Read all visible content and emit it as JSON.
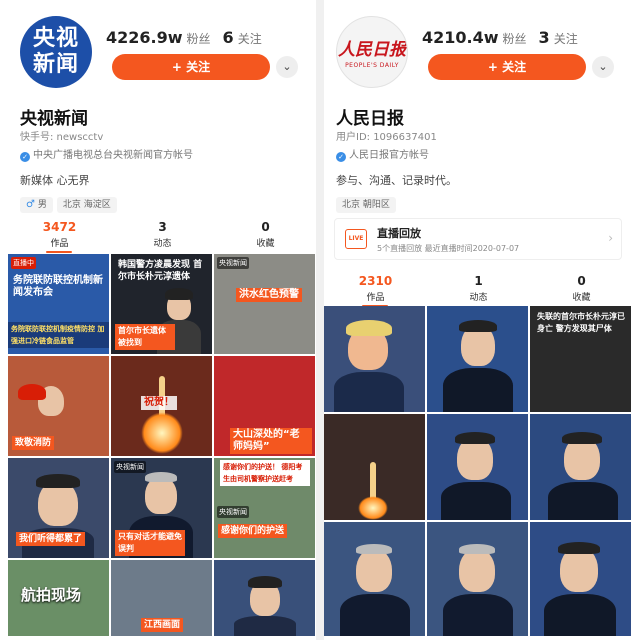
{
  "left": {
    "avatar_text": "央视\n新闻",
    "fans_count": "4226.9w",
    "fans_label": "粉丝",
    "follow_count": "6",
    "follow_label": "关注",
    "follow_button": "+ 关注",
    "more_icon": "chevron-down-icon",
    "name": "央视新闻",
    "account": "快手号: newscctv",
    "verification": "中央广播电视总台央视新闻官方帐号",
    "bio": "新媒体 心无界",
    "tags": [
      "男",
      "北京 海淀区"
    ],
    "tabs": [
      {
        "count": "3472",
        "label": "作品",
        "active": true
      },
      {
        "count": "3",
        "label": "动态",
        "active": false
      },
      {
        "count": "0",
        "label": "收藏",
        "active": false
      }
    ],
    "tiles": [
      {
        "caption": "务院联防联控机制新闻发布会",
        "badge": "直播中",
        "sub": "务院联防联控机制疫情防控 加强进口冷链食品监管",
        "bg": "#2a5aa8"
      },
      {
        "caption": "韩国警方凌晨发现 首尔市长朴元淳遗体",
        "badge": "",
        "sub": "首尔市长遗体被找到",
        "bg": "#20242c"
      },
      {
        "caption": "洪水红色预警",
        "badge": "央视新闻",
        "sub": "",
        "bg": "#8c8c86"
      },
      {
        "caption": "致敬消防",
        "badge": "",
        "sub": "",
        "bg": "#b85a3a"
      },
      {
        "caption": "祝贺！",
        "badge": "",
        "sub": "",
        "bg": "#6b2a1c"
      },
      {
        "caption": "大山深处的“老师妈妈”",
        "badge": "",
        "sub": "",
        "bg": "#c0282a"
      },
      {
        "caption": "我们听得都累了",
        "badge": "",
        "sub": "",
        "bg": "#3b4a6a"
      },
      {
        "caption": "只有对话才能避免误判",
        "badge": "央视新闻",
        "sub": "",
        "bg": "#2b3850"
      },
      {
        "caption": "感谢你们的护送",
        "badge": "央视新闻",
        "sub": "感谢你们的护送！ 德阳考生由司机警察护送赶考",
        "bg": "#6f8a6a"
      },
      {
        "caption": "航拍现场",
        "badge": "",
        "sub": "",
        "bg": "#6a8f66"
      },
      {
        "caption": "江西画面",
        "badge": "",
        "sub": "",
        "bg": "#6d7b8a"
      },
      {
        "caption": "",
        "badge": "",
        "sub": "",
        "bg": "#39507a"
      }
    ]
  },
  "right": {
    "avatar_logo": "人民日报",
    "avatar_sub": "PEOPLE'S DAILY",
    "fans_count": "4210.4w",
    "fans_label": "粉丝",
    "follow_count": "3",
    "follow_label": "关注",
    "follow_button": "+ 关注",
    "more_icon": "chevron-down-icon",
    "name": "人民日报",
    "account": "用户ID: 1096637401",
    "verification": "人民日报官方帐号",
    "bio": "参与、沟通、记录时代。",
    "tags": [
      "北京 朝阳区"
    ],
    "live": {
      "icon": "LIVE",
      "title": "直播回放",
      "sub": "5个直播回放 最近直播时间2020-07-07"
    },
    "tabs": [
      {
        "count": "2310",
        "label": "作品",
        "active": true
      },
      {
        "count": "1",
        "label": "动态",
        "active": false
      },
      {
        "count": "0",
        "label": "收藏",
        "active": false
      }
    ],
    "tiles": [
      {
        "caption": "",
        "bg": "#3a4f7a"
      },
      {
        "caption": "",
        "bg": "#2b4f8c"
      },
      {
        "caption": "失联的首尔市长朴元淳已身亡 警方发现其尸体",
        "bg": "#2a2a2a"
      },
      {
        "caption": "",
        "bg": "#3a2a26"
      },
      {
        "caption": "",
        "bg": "#2e4c86"
      },
      {
        "caption": "",
        "bg": "#2c4a80"
      },
      {
        "caption": "",
        "bg": "#3b5580"
      },
      {
        "caption": "",
        "bg": "#3b5580"
      },
      {
        "caption": "",
        "bg": "#2e4c86"
      }
    ]
  },
  "colors": {
    "accent": "#f4571f",
    "verified": "#3a8ee6"
  }
}
